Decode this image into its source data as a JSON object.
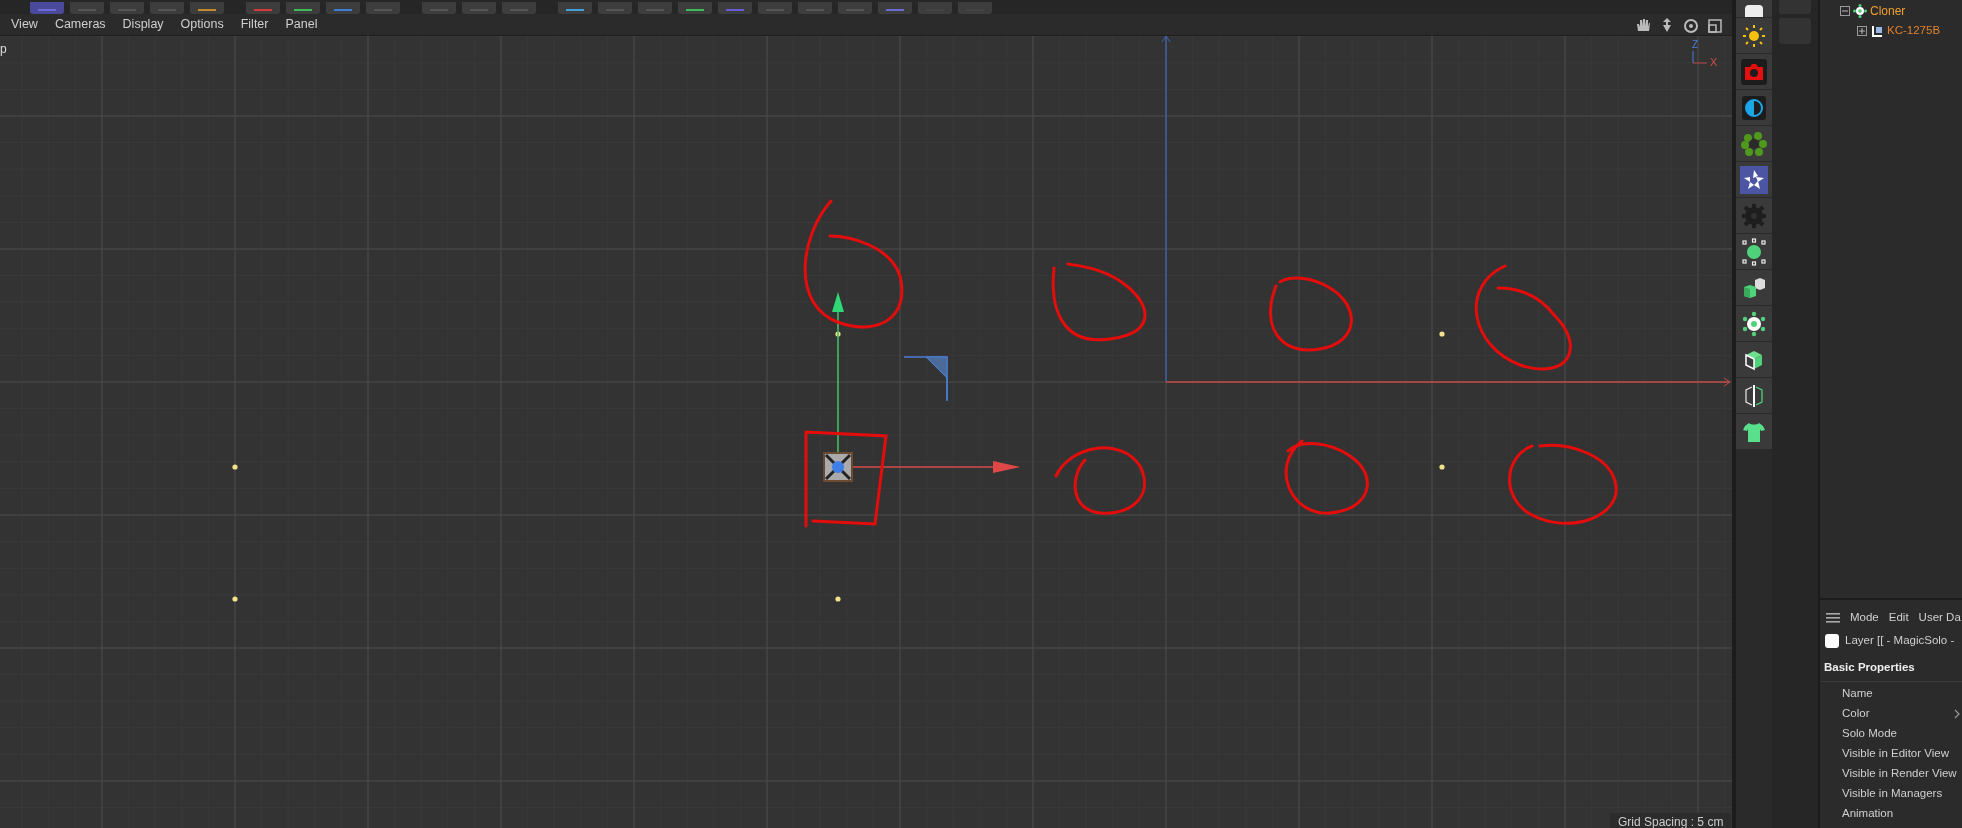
{
  "viewport_menu": [
    "View",
    "Cameras",
    "Display",
    "Options",
    "Filter",
    "Panel"
  ],
  "viewport_label": "p",
  "axis_labels": {
    "vertical": "Z",
    "horizontal": "X"
  },
  "grid_spacing": "Grid Spacing : 5 cm",
  "object_tree": [
    {
      "label": "Cloner",
      "expanded": true,
      "children": [
        {
          "label": "KC-1275B",
          "expanded": false
        }
      ]
    }
  ],
  "attributes": {
    "menu": [
      "Mode",
      "Edit",
      "User Da"
    ],
    "layer": "Layer [[ - MagicSolo -",
    "section": "Basic Properties",
    "properties": [
      {
        "label": "Name",
        "kind": "plain"
      },
      {
        "label": "Color",
        "kind": "expander"
      },
      {
        "label": "Solo Mode",
        "kind": "plain"
      },
      {
        "label": "Visible in Editor View",
        "kind": "plain"
      },
      {
        "label": "Visible in Render View",
        "kind": "plain"
      },
      {
        "label": "Visible in Managers",
        "kind": "plain"
      },
      {
        "label": "Animation",
        "kind": "plain"
      }
    ]
  }
}
